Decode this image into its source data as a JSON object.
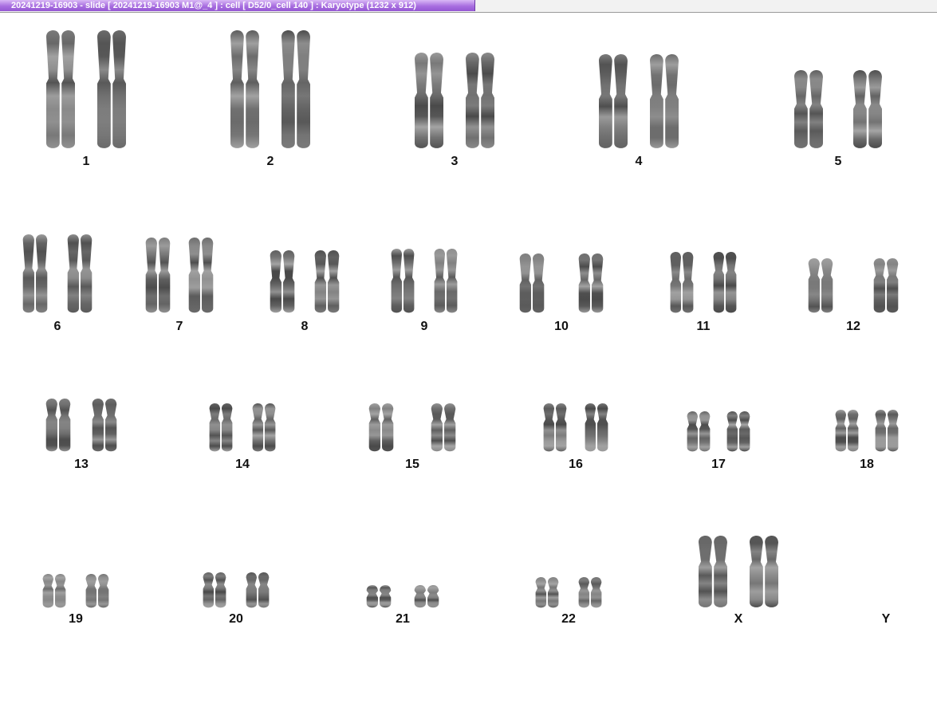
{
  "window": {
    "title": "20241219-16903 - slide [ 20241219-16903 M1@_4 ] : cell [ D52/0_cell 140 ] : Karyotype  (1232 x 912)"
  },
  "karyotype": {
    "chromosomes": [
      {
        "label": "1",
        "count": 2
      },
      {
        "label": "2",
        "count": 2
      },
      {
        "label": "3",
        "count": 2
      },
      {
        "label": "4",
        "count": 2
      },
      {
        "label": "5",
        "count": 2
      },
      {
        "label": "6",
        "count": 2
      },
      {
        "label": "7",
        "count": 2
      },
      {
        "label": "8",
        "count": 2
      },
      {
        "label": "9",
        "count": 2
      },
      {
        "label": "10",
        "count": 2
      },
      {
        "label": "11",
        "count": 2
      },
      {
        "label": "12",
        "count": 2
      },
      {
        "label": "13",
        "count": 2
      },
      {
        "label": "14",
        "count": 2
      },
      {
        "label": "15",
        "count": 2
      },
      {
        "label": "16",
        "count": 2
      },
      {
        "label": "17",
        "count": 2
      },
      {
        "label": "18",
        "count": 2
      },
      {
        "label": "19",
        "count": 2
      },
      {
        "label": "20",
        "count": 2
      },
      {
        "label": "21",
        "count": 2
      },
      {
        "label": "22",
        "count": 2
      },
      {
        "label": "X",
        "count": 2
      },
      {
        "label": "Y",
        "count": 0
      }
    ]
  }
}
